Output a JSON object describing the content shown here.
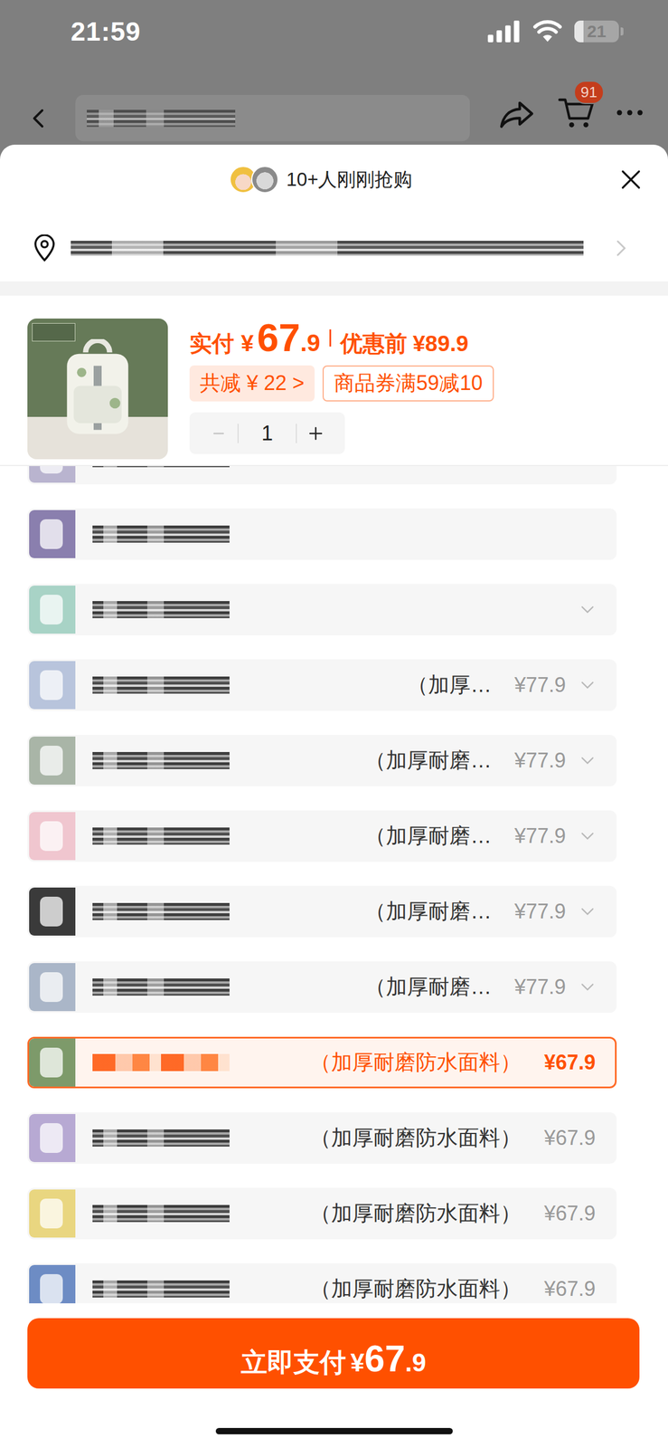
{
  "status_bar": {
    "time": "21:59",
    "battery": "21",
    "battery_level": 0.21
  },
  "nav": {
    "cart_badge": "91"
  },
  "sheet": {
    "header": "10+人刚刚抢购"
  },
  "product": {
    "paid_label": "实付",
    "currency": "¥",
    "price_int": "67",
    "price_dec": ".9",
    "original_label": "优惠前",
    "original_price": "¥89.9",
    "discount_tag": "共减 ¥ 22 >",
    "coupon_tag": "商品券满59减10",
    "quantity": "1",
    "minus_disabled": true
  },
  "options": [
    {
      "thumb_color": "#b9b4cf",
      "suffix": "",
      "price": "",
      "expandable": false,
      "selected": false
    },
    {
      "thumb_color": "#8a7fae",
      "suffix": "",
      "price": "",
      "expandable": false,
      "selected": false
    },
    {
      "thumb_color": "#a8d3c6",
      "suffix": "",
      "price": "",
      "expandable": true,
      "selected": false
    },
    {
      "thumb_color": "#b8c4dc",
      "suffix": "（加厚…",
      "price": "¥77.9",
      "expandable": true,
      "selected": false
    },
    {
      "thumb_color": "#a9b5a7",
      "suffix": "（加厚耐磨…",
      "price": "¥77.9",
      "expandable": true,
      "selected": false
    },
    {
      "thumb_color": "#f0c6cf",
      "suffix": "（加厚耐磨…",
      "price": "¥77.9",
      "expandable": true,
      "selected": false
    },
    {
      "thumb_color": "#3a3a3a",
      "suffix": "（加厚耐磨…",
      "price": "¥77.9",
      "expandable": true,
      "selected": false
    },
    {
      "thumb_color": "#aab6c8",
      "suffix": "（加厚耐磨…",
      "price": "¥77.9",
      "expandable": true,
      "selected": false
    },
    {
      "thumb_color": "#7d9a6a",
      "suffix": "（加厚耐磨防水面料）",
      "price": "¥67.9",
      "expandable": false,
      "selected": true
    },
    {
      "thumb_color": "#b7a9d3",
      "suffix": "（加厚耐磨防水面料）",
      "price": "¥67.9",
      "expandable": false,
      "selected": false
    },
    {
      "thumb_color": "#e9d680",
      "suffix": "（加厚耐磨防水面料）",
      "price": "¥67.9",
      "expandable": false,
      "selected": false
    },
    {
      "thumb_color": "#6d8cc4",
      "suffix": "（加厚耐磨防水面料）",
      "price": "¥67.9",
      "expandable": false,
      "selected": false
    },
    {
      "thumb_color": "#8fa3c9",
      "suffix": "",
      "price": "",
      "expandable": false,
      "selected": false
    }
  ],
  "pay_button": {
    "label": "立即支付",
    "currency": "¥",
    "price_int": "67",
    "price_dec": ".9"
  }
}
